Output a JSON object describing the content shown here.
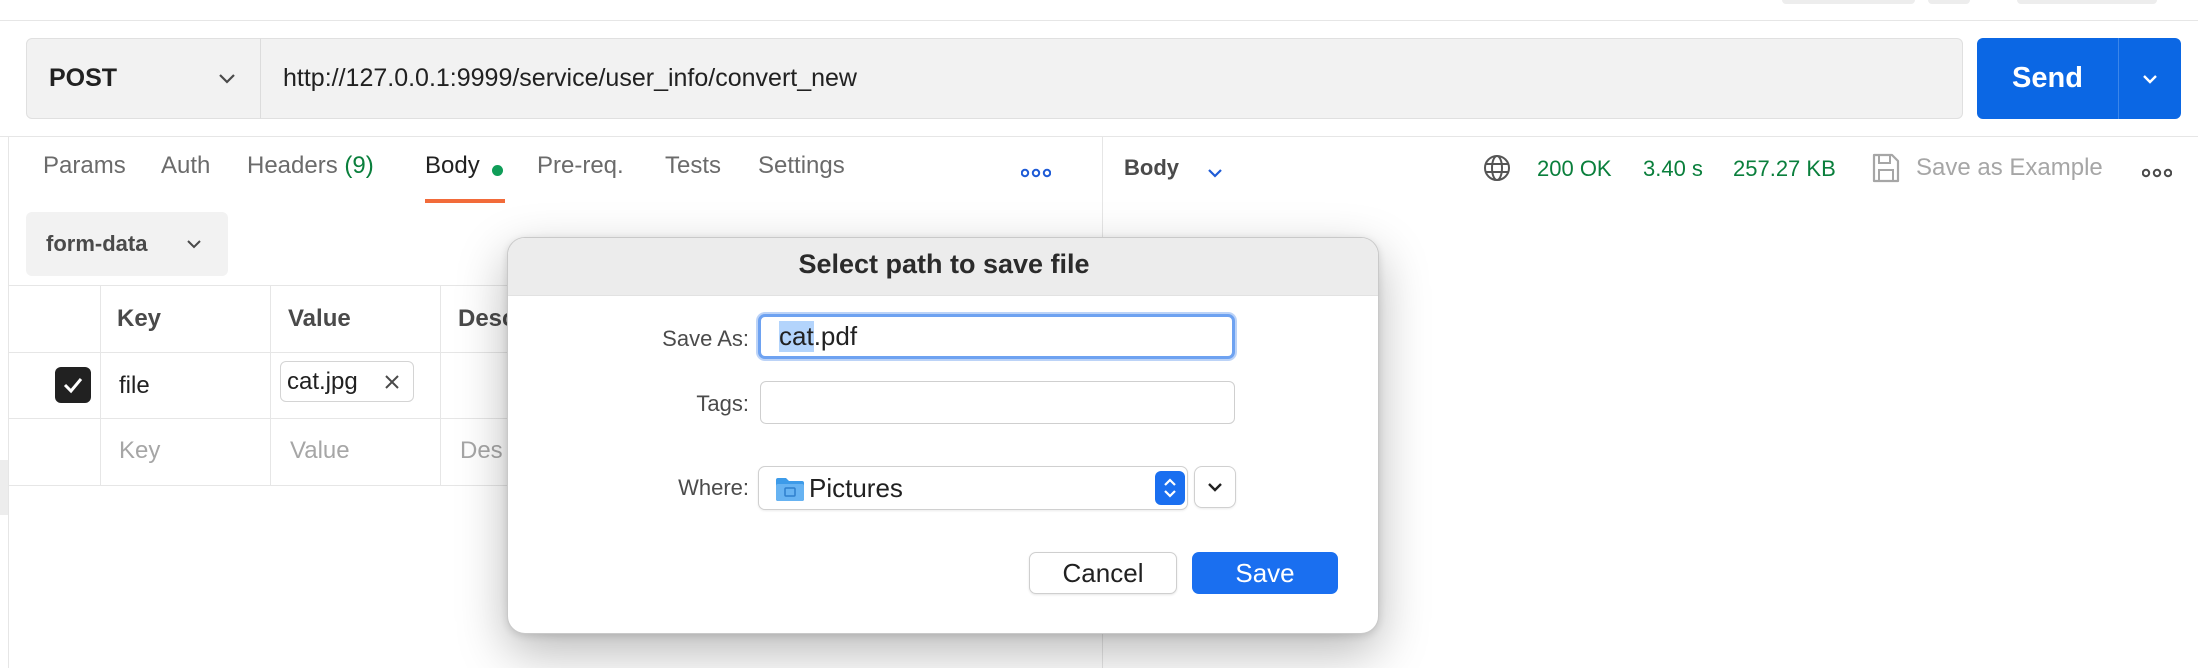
{
  "request": {
    "method": "POST",
    "url": "http://127.0.0.1:9999/service/user_info/convert_new",
    "send_label": "Send"
  },
  "tabs": {
    "params": "Params",
    "auth": "Auth",
    "headers": "Headers",
    "headers_count": "(9)",
    "body": "Body",
    "prereq": "Pre-req.",
    "tests": "Tests",
    "settings": "Settings"
  },
  "body": {
    "mode": "form-data",
    "table": {
      "headers": {
        "key": "Key",
        "value": "Value",
        "description": "Desc"
      },
      "rows": [
        {
          "checked": true,
          "key": "file",
          "value": "cat.jpg"
        }
      ],
      "placeholder": {
        "key": "Key",
        "value": "Value",
        "description": "Des"
      }
    }
  },
  "response": {
    "body_label": "Body",
    "status": "200 OK",
    "time": "3.40 s",
    "size": "257.27 KB",
    "save_example": "Save as Example"
  },
  "dialog": {
    "title": "Select path to save file",
    "save_as_label": "Save As:",
    "filename_selected": "cat",
    "filename_rest": ".pdf",
    "tags_label": "Tags:",
    "tags_value": "",
    "where_label": "Where:",
    "where_value": "Pictures",
    "cancel": "Cancel",
    "save": "Save"
  },
  "colors": {
    "accent": "#0b67e4",
    "success": "#0a7f3c",
    "active_tab_underline": "#f26b3a",
    "dialog_primary": "#1a6ff0"
  },
  "icons": [
    "chevron-down-icon",
    "more-horizontal-icon",
    "globe-icon",
    "save-icon",
    "check-icon",
    "close-icon",
    "folder-icon",
    "stepper-icon"
  ]
}
